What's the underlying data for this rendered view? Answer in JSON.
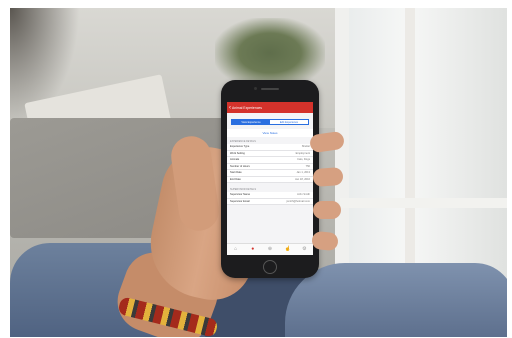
{
  "app": {
    "title": "Animal Experiences",
    "back_icon": "chevron-left-icon"
  },
  "tabs": [
    {
      "label": "View Experience",
      "active": true
    },
    {
      "label": "Edit Experience",
      "active": false
    }
  ],
  "view_notes_label": "View Notes",
  "sections": [
    {
      "header": "EXPERIENCE DETAILS",
      "rows": [
        {
          "key": "Experience Type",
          "value": "Shelter"
        },
        {
          "key": "Work Setting",
          "value": "Employment"
        },
        {
          "key": "Animals",
          "value": "Cats, Dogs"
        },
        {
          "key": "Number of Hours",
          "value": "750"
        },
        {
          "key": "Start Date",
          "value": "Jan 1, 2013"
        },
        {
          "key": "End Date",
          "value": "Jan 18, 2016"
        }
      ]
    },
    {
      "header": "SUPERVISOR DETAILS",
      "rows": [
        {
          "key": "Supervisor Name",
          "value": "John Smith"
        },
        {
          "key": "Supervisor Email",
          "value": "jsmith@hotmail.com"
        }
      ]
    }
  ],
  "tabbar": [
    {
      "icon": "home-icon",
      "active": false
    },
    {
      "icon": "paw-icon",
      "active": true
    },
    {
      "icon": "plus-circle-icon",
      "active": false
    },
    {
      "icon": "thumbs-up-icon",
      "active": false
    },
    {
      "icon": "gear-icon",
      "active": false
    }
  ],
  "colors": {
    "accent": "#d4322b",
    "link": "#2a6fe0"
  }
}
